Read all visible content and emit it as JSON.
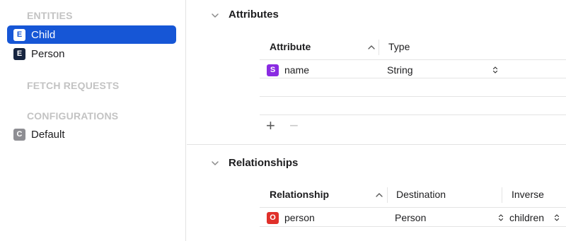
{
  "sidebar": {
    "entities_header": "ENTITIES",
    "entities": [
      {
        "badge": "E",
        "label": "Child"
      },
      {
        "badge": "E",
        "label": "Person"
      }
    ],
    "fetch_requests_header": "FETCH REQUESTS",
    "configurations_header": "CONFIGURATIONS",
    "configurations": [
      {
        "badge": "C",
        "label": "Default"
      }
    ]
  },
  "attributes": {
    "title": "Attributes",
    "columns": [
      "Attribute",
      "Type"
    ],
    "rows": [
      {
        "badge": "S",
        "name": "name",
        "type": "String"
      }
    ],
    "add_label": "+",
    "remove_label": "−"
  },
  "relationships": {
    "title": "Relationships",
    "columns": [
      "Relationship",
      "Destination",
      "Inverse"
    ],
    "rows": [
      {
        "badge": "O",
        "name": "person",
        "destination": "Person",
        "inverse": "children"
      }
    ]
  },
  "colors": {
    "selection": "#1656d6",
    "entity_badge": "#172540",
    "string_badge": "#8a2be2",
    "to_one_badge": "#e0302a",
    "config_badge": "#8e8e93"
  }
}
